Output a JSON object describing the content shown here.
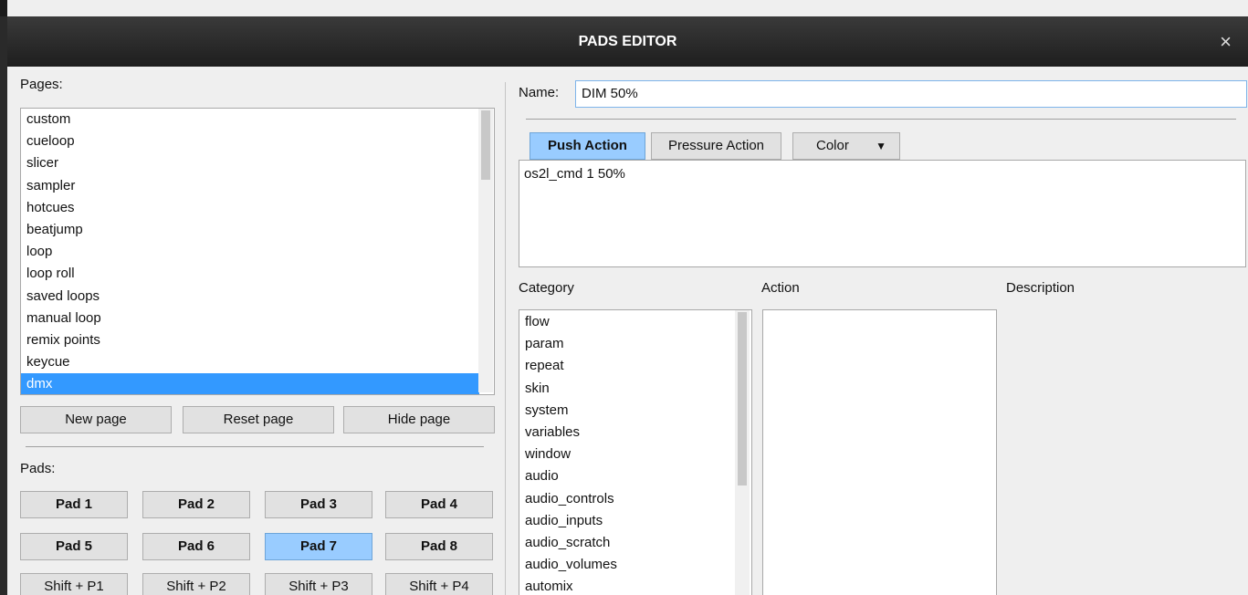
{
  "window": {
    "title": "PADS EDITOR",
    "close_glyph": "×"
  },
  "pages": {
    "label": "Pages:",
    "items": [
      "custom",
      "cueloop",
      "slicer",
      "sampler",
      "hotcues",
      "beatjump",
      "loop",
      "loop roll",
      "saved loops",
      "manual loop",
      "remix points",
      "keycue",
      "dmx"
    ],
    "selected": "dmx",
    "buttons": {
      "new": "New page",
      "reset": "Reset page",
      "hide": "Hide page"
    }
  },
  "pads": {
    "label": "Pads:",
    "items": [
      "Pad 1",
      "Pad 2",
      "Pad 3",
      "Pad 4",
      "Pad 5",
      "Pad 6",
      "Pad 7",
      "Pad 8",
      "Shift + P1",
      "Shift + P2",
      "Shift + P3",
      "Shift + P4"
    ],
    "selected": "Pad 7"
  },
  "editor": {
    "name_label": "Name:",
    "name_value": "DIM 50%",
    "tabs": {
      "push": "Push Action",
      "pressure": "Pressure Action",
      "color": "Color"
    },
    "active_tab": "Push Action",
    "script": "os2l_cmd 1 50%"
  },
  "browser": {
    "category_label": "Category",
    "action_label": "Action",
    "description_label": "Description",
    "categories": [
      "flow",
      "param",
      "repeat",
      "skin",
      "system",
      "variables",
      "window",
      "audio",
      "audio_controls",
      "audio_inputs",
      "audio_scratch",
      "audio_volumes",
      "automix"
    ]
  }
}
